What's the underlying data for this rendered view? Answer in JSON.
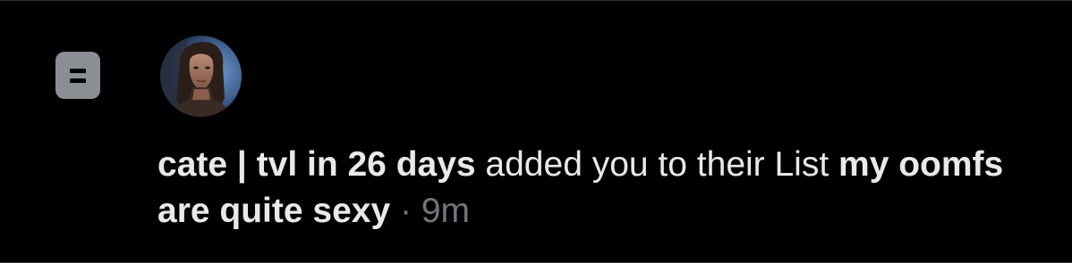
{
  "notification": {
    "icon": "list-icon",
    "avatar_alt": "profile-avatar",
    "user_name": "cate | tvl in 26 days",
    "action_text": " added you to their List ",
    "list_name": "my oomfs are quite sexy",
    "separator": " · ",
    "time_ago": "9m"
  },
  "colors": {
    "background": "#000000",
    "primary_text": "#e7e9ea",
    "secondary_text": "#71767b",
    "icon_bg": "#8b8f94"
  }
}
